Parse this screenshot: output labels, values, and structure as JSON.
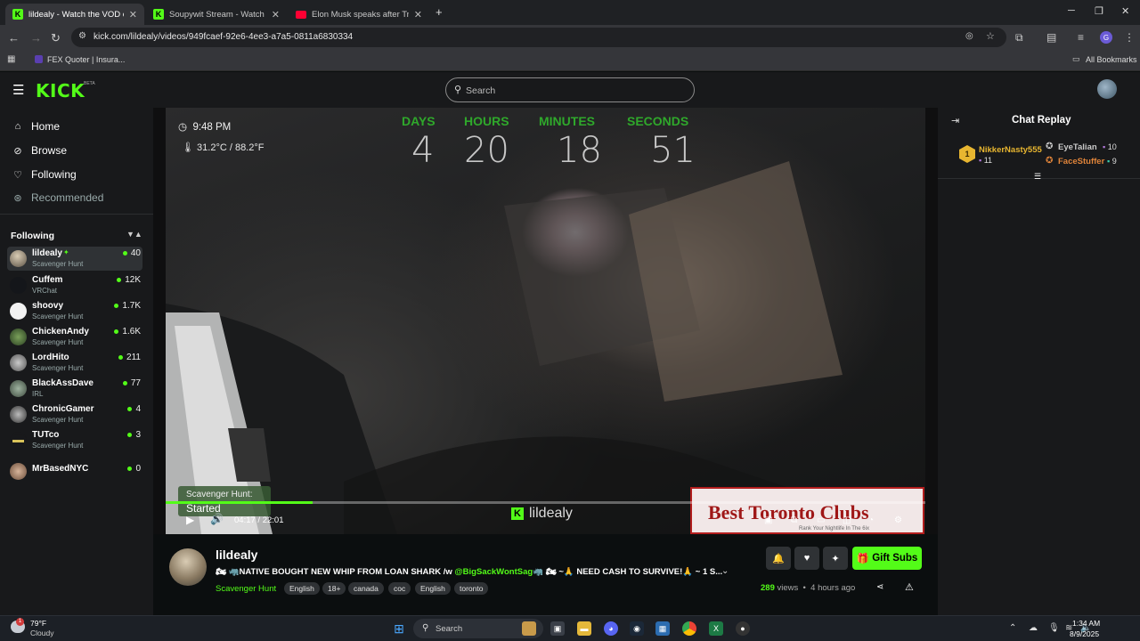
{
  "browser": {
    "tabs": [
      {
        "title": "lildealy - Watch the VOD on Ki",
        "favicon": "kick-icon",
        "active": true
      },
      {
        "title": "Soupywit Stream - Watch Live o",
        "favicon": "kick-icon",
        "active": false
      },
      {
        "title": "Elon Musk speaks after Trump",
        "favicon": "youtube-icon",
        "active": false
      }
    ],
    "url": "kick.com/lildealy/videos/949fcaef-92e6-4ee3-a7a5-0811a6830334",
    "profile_initial": "G",
    "bookmarks": [
      "FEX Quoter | Insura..."
    ],
    "all_bookmarks": "All Bookmarks"
  },
  "header": {
    "logo": "KICK",
    "beta": "BETA",
    "search_placeholder": "Search"
  },
  "sidebar": {
    "nav": [
      {
        "label": "Home",
        "icon": "home-icon"
      },
      {
        "label": "Browse",
        "icon": "browse-icon"
      },
      {
        "label": "Following",
        "icon": "heart-icon"
      },
      {
        "label": "Recommended",
        "icon": "recommended-icon"
      }
    ],
    "following_title": "Following",
    "following": [
      {
        "name": "lildealy",
        "category": "Scavenger Hunt",
        "viewers": "40",
        "verified": true
      },
      {
        "name": "Cuffem",
        "category": "VRChat",
        "viewers": "12K"
      },
      {
        "name": "shoovy",
        "category": "Scavenger Hunt",
        "viewers": "1.7K"
      },
      {
        "name": "ChickenAndy",
        "category": "Scavenger Hunt",
        "viewers": "1.6K"
      },
      {
        "name": "LordHito",
        "category": "Scavenger Hunt",
        "viewers": "211"
      },
      {
        "name": "BlackAssDave",
        "category": "IRL",
        "viewers": "77"
      },
      {
        "name": "ChronicGamer",
        "category": "Scavenger Hunt",
        "viewers": "4"
      },
      {
        "name": "TUTco",
        "category": "Scavenger Hunt",
        "viewers": "3"
      },
      {
        "name": "MrBasedNYC",
        "category": "",
        "viewers": "0"
      }
    ]
  },
  "video": {
    "overlay_time": "9:48 PM",
    "overlay_temp": "31.2°C / 88.2°F",
    "countdown": [
      {
        "label": "DAYS",
        "value": "4"
      },
      {
        "label": "HOURS",
        "value": "20"
      },
      {
        "label": "MINUTES",
        "value": "18"
      },
      {
        "label": "SECONDS",
        "value": "51"
      }
    ],
    "scavenger_line1": "Scavenger Hunt:",
    "scavenger_line2": "Started",
    "current_time": "04:17",
    "duration": "22:01",
    "progress_fraction": 0.194,
    "watermark": "lildealy",
    "ad_title": "Best Toronto Clubs",
    "ad_subtitle": "Rank Your Nightlife In The 6ix"
  },
  "chat": {
    "title": "Chat Replay",
    "gifters": [
      {
        "rank": "1",
        "name": "NikkerNasty555",
        "count": "11",
        "color": "#e8b630"
      },
      {
        "name": "EyeTalian",
        "count": "10",
        "color": "#c9c9c9"
      },
      {
        "name": "FaceStuffer",
        "count": "9",
        "color": "#e0843a"
      }
    ]
  },
  "channel": {
    "name": "lildealy",
    "title_pre": "🏍 🦏NATIVE BOUGHT NEW WHIP FROM LOAN SHARK /w ",
    "title_mention": "@BigSackWontSag",
    "title_post": "🦏 🏍 ~🙏 NEED CASH TO SURVIVE!🙏 ~ 1 S...",
    "category": "Scavenger Hunt",
    "tags": [
      "English",
      "18+",
      "canada",
      "coc",
      "English",
      "toronto"
    ],
    "gift_label": "Gift Subs",
    "views_count": "289",
    "views_label": "views",
    "ago": "4 hours ago"
  },
  "taskbar": {
    "weather_temp": "79°F",
    "weather_cond": "Cloudy",
    "weather_badge": "1",
    "search_placeholder": "Search",
    "time": "1:34 AM",
    "date": "8/9/2025"
  },
  "colors": {
    "kick_green": "#53fc18",
    "bg": "#0b0e0f",
    "panel": "#18191b"
  }
}
